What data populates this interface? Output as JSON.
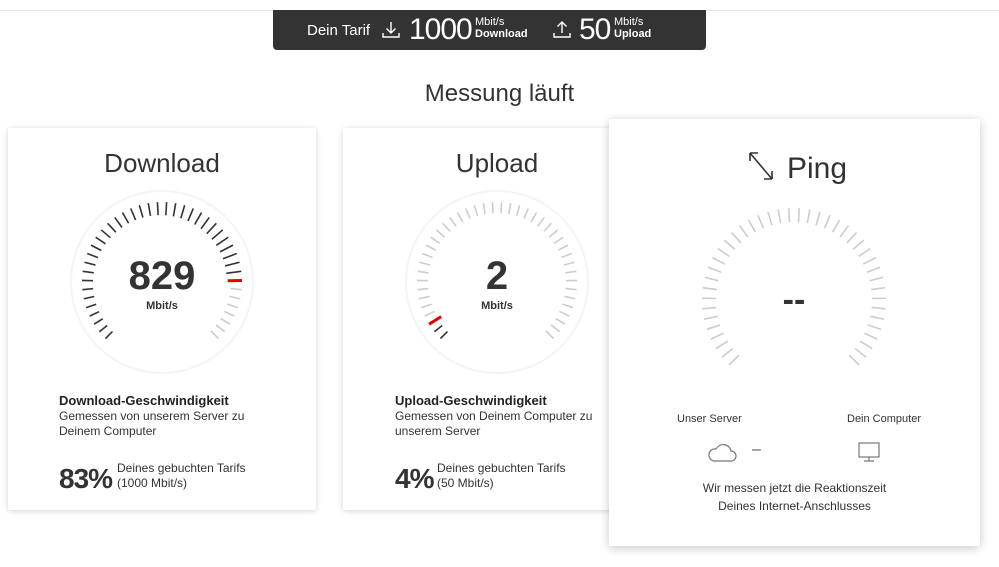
{
  "tarif": {
    "label": "Dein Tarif",
    "download_value": "1000",
    "download_unit": "Mbit/s",
    "download_label": "Download",
    "upload_value": "50",
    "upload_unit": "Mbit/s",
    "upload_label": "Upload"
  },
  "headline": "Messung läuft",
  "download": {
    "title": "Download",
    "value": "829",
    "unit": "Mbit/s",
    "gauge_level": 0.83,
    "desc_title": "Download-Geschwindigkeit",
    "desc_line1": "Gemessen von unserem Server zu",
    "desc_line2": "Deinem Computer",
    "percent": "83%",
    "percent_line1": "Deines gebuchten Tarifs",
    "percent_line2": "(1000 Mbit/s)"
  },
  "upload": {
    "title": "Upload",
    "value": "2",
    "unit": "Mbit/s",
    "gauge_level": 0.04,
    "desc_title": "Upload-Geschwindigkeit",
    "desc_line1": "Gemessen von Deinem Computer zu",
    "desc_line2": "unserem Server",
    "percent": "4%",
    "percent_line1": "Deines gebuchten Tarifs",
    "percent_line2": "(50 Mbit/s)"
  },
  "ping": {
    "title": "Ping",
    "value": "--",
    "server_label": "Unser Server",
    "computer_label": "Dein Computer",
    "connector": "–",
    "info_line1": "Wir messen jetzt die Reaktionszeit",
    "info_line2": "Deines Internet-Anschlusses"
  },
  "colors": {
    "accent": "#e60000",
    "tarif_bar": "#333333",
    "tick_active": "#333333",
    "tick_inactive": "#cccccc"
  },
  "icons": {
    "download": "download-icon",
    "upload": "upload-icon",
    "ping": "ping-arrows-icon",
    "server": "cloud-icon",
    "computer": "monitor-icon"
  }
}
